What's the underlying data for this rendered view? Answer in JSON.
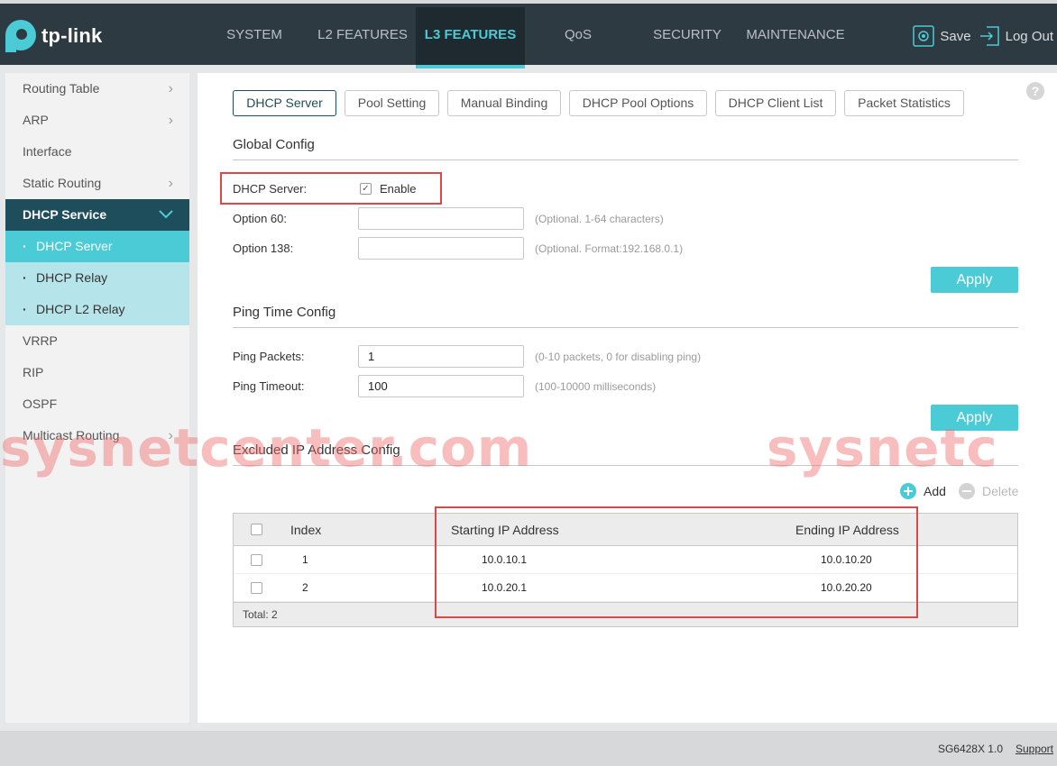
{
  "header": {
    "brand": "tp-link",
    "nav": [
      {
        "label": "SYSTEM",
        "active": false
      },
      {
        "label": "L2 FEATURES",
        "active": false
      },
      {
        "label": "L3 FEATURES",
        "active": true
      },
      {
        "label": "QoS",
        "active": false
      },
      {
        "label": "SECURITY",
        "active": false
      },
      {
        "label": "MAINTENANCE",
        "active": false
      }
    ],
    "save_label": "Save",
    "logout_label": "Log Out"
  },
  "sidebar": {
    "items": [
      {
        "label": "Routing Table",
        "chevron": true
      },
      {
        "label": "ARP",
        "chevron": true
      },
      {
        "label": "Interface",
        "chevron": false
      },
      {
        "label": "Static Routing",
        "chevron": true
      },
      {
        "label": "DHCP Service",
        "expanded": true
      },
      {
        "label": "DHCP Server",
        "active": true
      },
      {
        "label": "DHCP Relay"
      },
      {
        "label": "DHCP L2 Relay"
      },
      {
        "label": "VRRP"
      },
      {
        "label": "RIP"
      },
      {
        "label": "OSPF"
      },
      {
        "label": "Multicast Routing",
        "chevron": true
      }
    ]
  },
  "tabs": [
    {
      "label": "DHCP Server",
      "active": true
    },
    {
      "label": "Pool Setting"
    },
    {
      "label": "Manual Binding"
    },
    {
      "label": "DHCP Pool Options"
    },
    {
      "label": "DHCP Client List"
    },
    {
      "label": "Packet Statistics"
    }
  ],
  "global_config": {
    "title": "Global Config",
    "dhcp_server_label": "DHCP Server:",
    "enable_label": "Enable",
    "enabled": true,
    "option60_label": "Option 60:",
    "option60_value": "",
    "option60_hint": "(Optional. 1-64 characters)",
    "option138_label": "Option 138:",
    "option138_value": "",
    "option138_hint": "(Optional. Format:192.168.0.1)",
    "apply_label": "Apply"
  },
  "ping_config": {
    "title": "Ping Time Config",
    "packets_label": "Ping Packets:",
    "packets_value": "1",
    "packets_hint": "(0-10 packets, 0 for disabling ping)",
    "timeout_label": "Ping Timeout:",
    "timeout_value": "100",
    "timeout_hint": "(100-10000 milliseconds)",
    "apply_label": "Apply"
  },
  "excluded": {
    "title": "Excluded IP Address Config",
    "add_label": "Add",
    "delete_label": "Delete",
    "columns": {
      "index": "Index",
      "start": "Starting IP Address",
      "end": "Ending IP Address"
    },
    "rows": [
      {
        "index": "1",
        "start": "10.0.10.1",
        "end": "10.0.10.20"
      },
      {
        "index": "2",
        "start": "10.0.20.1",
        "end": "10.0.20.20"
      }
    ],
    "total_label": "Total: 2"
  },
  "watermark": {
    "text_left": "sysnetcenter.com",
    "text_right": "sysnetc"
  },
  "footer": {
    "model": "SG6428X 1.0",
    "support_label": "Support"
  },
  "colors": {
    "accent": "#4acbd6",
    "topbar": "#2d3a41",
    "sidebar_group": "#1e4e5c",
    "highlight_box": "#e04646"
  }
}
